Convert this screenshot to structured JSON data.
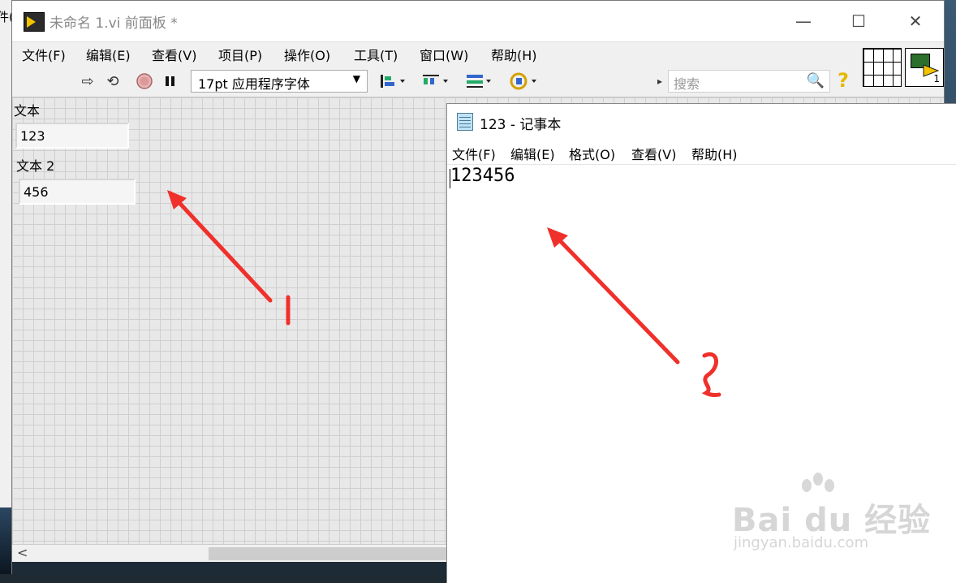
{
  "background_window": {
    "partial_text": "件("
  },
  "labview": {
    "title": "未命名 1.vi 前面板 *",
    "window_controls": {
      "minimize": "—",
      "maximize": "☐",
      "close": "✕"
    },
    "menu": [
      "文件(F)",
      "编辑(E)",
      "查看(V)",
      "项目(P)",
      "操作(O)",
      "工具(T)",
      "窗口(W)",
      "帮助(H)"
    ],
    "toolbar": {
      "font_select": "17pt 应用程序字体",
      "search_placeholder": "搜索"
    },
    "icon_number": "1",
    "controls": [
      {
        "label": "文本",
        "value": "123"
      },
      {
        "label": "文本 2",
        "value": "456"
      }
    ]
  },
  "notepad": {
    "title": "123 - 记事本",
    "menu": [
      "文件(F)",
      "编辑(E)",
      "格式(O)",
      "查看(V)",
      "帮助(H)"
    ],
    "content": "123456"
  },
  "annotations": {
    "arrow_color": "#f0302a"
  },
  "watermark": {
    "brand": "Bai du 经验",
    "url": "jingyan.baidu.com"
  }
}
